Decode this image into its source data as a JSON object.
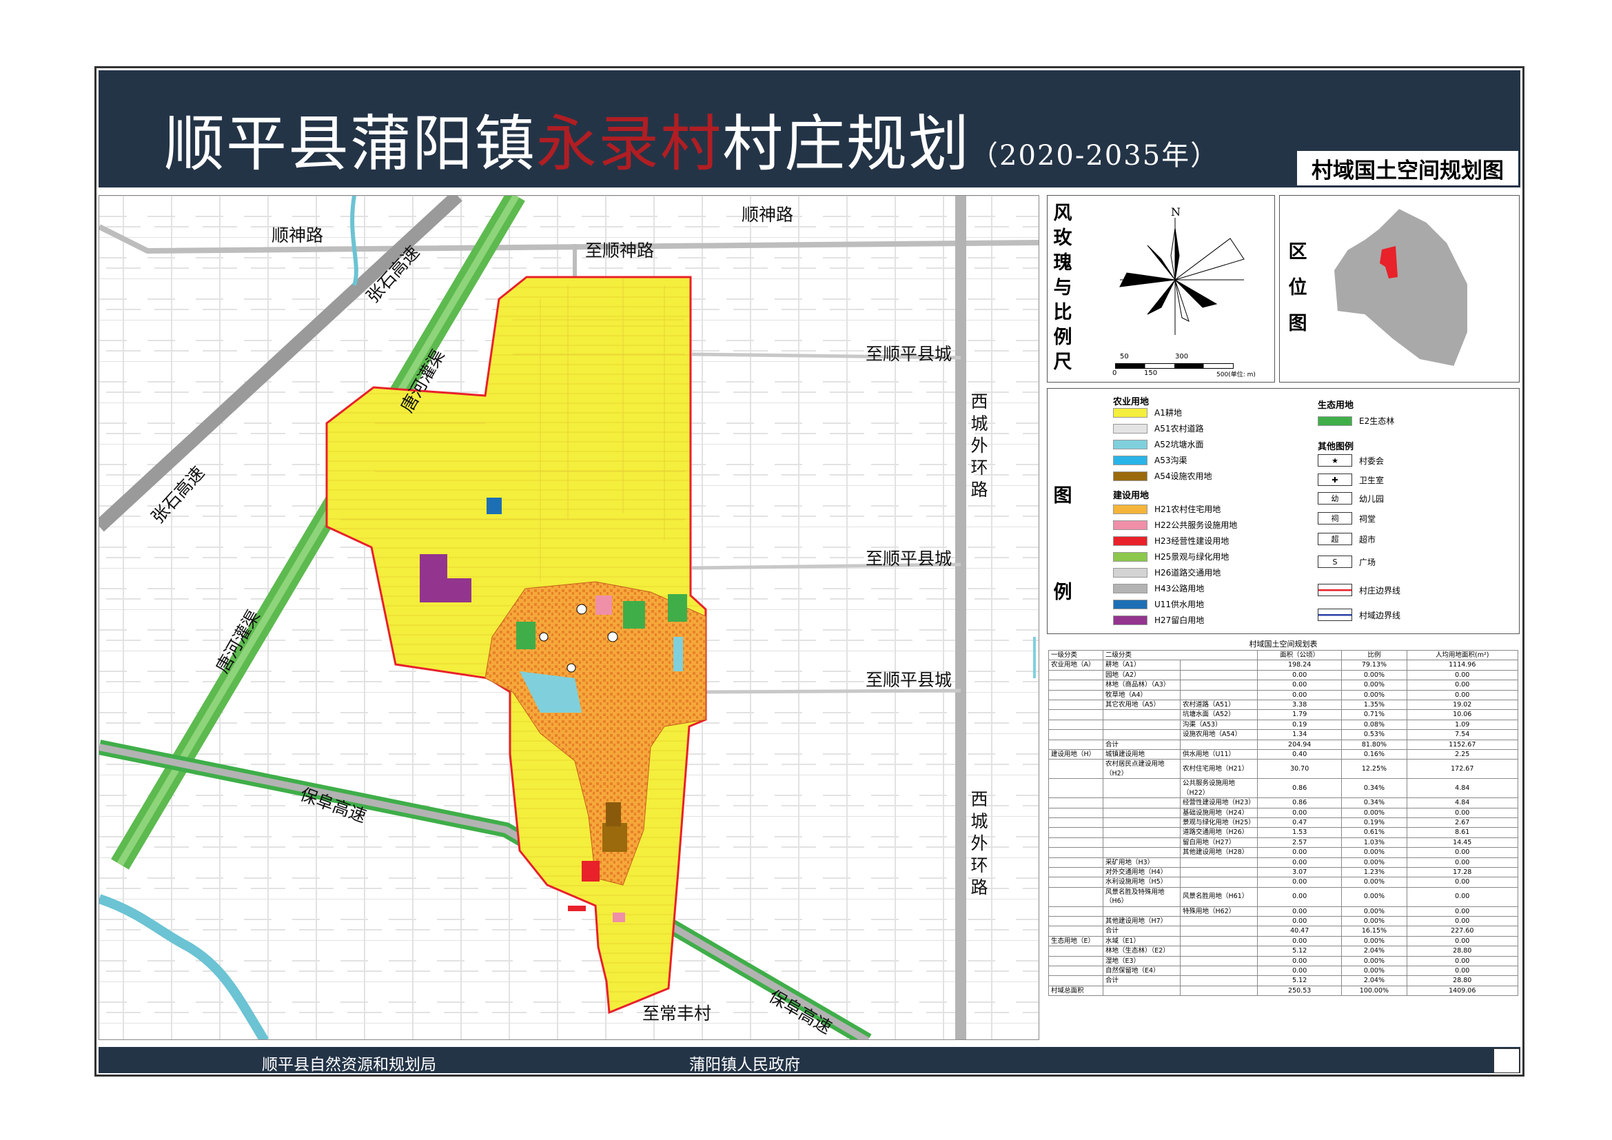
{
  "title": {
    "prefix": "顺平县蒲阳镇",
    "village": "永录村",
    "suffix": "村庄规划",
    "years": "（2020-2035年）"
  },
  "subtitle": "村域国土空间规划图",
  "map": {
    "roads": {
      "shunshen_top": "顺神路",
      "shunshen_left": "顺神路",
      "to_shunshen": "至顺神路",
      "zhangshi_upper": "张石高速",
      "zhangshi_lower": "张石高速",
      "tanghe_upper": "唐河灌渠",
      "tanghe_lower": "唐河灌渠",
      "to_county_1": "至顺平县城",
      "to_county_2": "至顺平县城",
      "to_county_3": "至顺平县城",
      "xicheng_upper": "西城外环路",
      "xicheng_lower": "西城外环路",
      "baofu_left": "保阜高速",
      "baofu_right": "保阜高速",
      "to_changfeng": "至常丰村"
    }
  },
  "rose": {
    "title": "风玫瑰与比例尺",
    "north": "N",
    "scale_top": [
      "50",
      "300"
    ],
    "scale_bottom": [
      "0",
      "150",
      "500(单位: m)"
    ]
  },
  "location": {
    "title": "区位图"
  },
  "legend": {
    "title": "图例",
    "groups": {
      "agri": "农业用地",
      "build": "建设用地",
      "eco": "生态用地",
      "other": "其他图例"
    },
    "items": [
      {
        "label": "A1耕地",
        "color": "#f4ee3c"
      },
      {
        "label": "A51农村道路",
        "color": "#e4e4e4"
      },
      {
        "label": "A52坑塘水面",
        "color": "#7fd0dc"
      },
      {
        "label": "A53沟渠",
        "color": "#2ab3e6"
      },
      {
        "label": "A54设施农用地",
        "color": "#9a6a0c"
      },
      {
        "label": "H21农村住宅用地",
        "color": "#f5b43a"
      },
      {
        "label": "H22公共服务设施用地",
        "color": "#ef8fa8"
      },
      {
        "label": "H23经营性建设用地",
        "color": "#e8212a"
      },
      {
        "label": "H25景观与绿化用地",
        "color": "#8cc84b"
      },
      {
        "label": "H26道路交通用地",
        "color": "#d3d3d3"
      },
      {
        "label": "H43公路用地",
        "color": "#b3b3b3"
      },
      {
        "label": "U11供水用地",
        "color": "#1d6fb5"
      },
      {
        "label": "H27留白用地",
        "color": "#93358e"
      }
    ],
    "eco_items": [
      {
        "label": "E2生态林",
        "color": "#3fae49"
      }
    ],
    "symbols": [
      {
        "label": "村委会",
        "glyph": "★"
      },
      {
        "label": "卫生室",
        "glyph": "✚"
      },
      {
        "label": "幼儿园",
        "glyph": "幼"
      },
      {
        "label": "祠堂",
        "glyph": "祠"
      },
      {
        "label": "超市",
        "glyph": "超"
      },
      {
        "label": "广场",
        "glyph": "S"
      }
    ],
    "lines": [
      {
        "label": "村庄边界线",
        "color": "#e8212a"
      },
      {
        "label": "村域边界线",
        "color": "#2b3fa8"
      }
    ]
  },
  "table": {
    "caption": "村域国土空间规划表",
    "headers": [
      "一级分类",
      "二级分类",
      "面积（公顷）",
      "比例",
      "人均用地面积(m²)"
    ],
    "rows": [
      [
        "农业用地（A）",
        "耕地（A1）",
        "",
        "198.24",
        "79.13%",
        "1114.96"
      ],
      [
        "",
        "园地（A2）",
        "",
        "0.00",
        "0.00%",
        "0.00"
      ],
      [
        "",
        "林地（商品林）（A3）",
        "",
        "0.00",
        "0.00%",
        "0.00"
      ],
      [
        "",
        "牧草地（A4）",
        "",
        "0.00",
        "0.00%",
        "0.00"
      ],
      [
        "",
        "其它农用地（A5）",
        "农村道路（A51）",
        "3.38",
        "1.35%",
        "19.02"
      ],
      [
        "",
        "",
        "坑塘水面（A52）",
        "1.79",
        "0.71%",
        "10.06"
      ],
      [
        "",
        "",
        "沟渠（A53）",
        "0.19",
        "0.08%",
        "1.09"
      ],
      [
        "",
        "",
        "设施农用地（A54）",
        "1.34",
        "0.53%",
        "7.54"
      ],
      [
        "",
        "合计",
        "",
        "204.94",
        "81.80%",
        "1152.67"
      ],
      [
        "建设用地（H）",
        "城镇建设用地",
        "供水用地（U11）",
        "0.40",
        "0.16%",
        "2.25"
      ],
      [
        "",
        "农村居民点建设用地（H2）",
        "农村住宅用地（H21）",
        "30.70",
        "12.25%",
        "172.67"
      ],
      [
        "",
        "",
        "公共服务设施用地（H22）",
        "0.86",
        "0.34%",
        "4.84"
      ],
      [
        "",
        "",
        "经营性建设用地（H23）",
        "0.86",
        "0.34%",
        "4.84"
      ],
      [
        "",
        "",
        "基础设施用地（H24）",
        "0.00",
        "0.00%",
        "0.00"
      ],
      [
        "",
        "",
        "景观与绿化用地（H25）",
        "0.47",
        "0.19%",
        "2.67"
      ],
      [
        "",
        "",
        "道路交通用地（H26）",
        "1.53",
        "0.61%",
        "8.61"
      ],
      [
        "",
        "",
        "留白用地（H27）",
        "2.57",
        "1.03%",
        "14.45"
      ],
      [
        "",
        "",
        "其他建设用地（H28）",
        "0.00",
        "0.00%",
        "0.00"
      ],
      [
        "",
        "采矿用地（H3）",
        "",
        "0.00",
        "0.00%",
        "0.00"
      ],
      [
        "",
        "对外交通用地（H4）",
        "",
        "3.07",
        "1.23%",
        "17.28"
      ],
      [
        "",
        "水利设施用地（H5）",
        "",
        "0.00",
        "0.00%",
        "0.00"
      ],
      [
        "",
        "风景名胜及特殊用地（H6）",
        "风景名胜用地（H61）",
        "0.00",
        "0.00%",
        "0.00"
      ],
      [
        "",
        "",
        "特殊用地（H62）",
        "0.00",
        "0.00%",
        "0.00"
      ],
      [
        "",
        "其他建设用地（H7）",
        "",
        "0.00",
        "0.00%",
        "0.00"
      ],
      [
        "",
        "合计",
        "",
        "40.47",
        "16.15%",
        "227.60"
      ],
      [
        "生态用地（E）",
        "水域（E1）",
        "",
        "0.00",
        "0.00%",
        "0.00"
      ],
      [
        "",
        "林地（生态林）（E2）",
        "",
        "5.12",
        "2.04%",
        "28.80"
      ],
      [
        "",
        "湿地（E3）",
        "",
        "0.00",
        "0.00%",
        "0.00"
      ],
      [
        "",
        "自然保留地（E4）",
        "",
        "0.00",
        "0.00%",
        "0.00"
      ],
      [
        "",
        "合计",
        "",
        "5.12",
        "2.04%",
        "28.80"
      ],
      [
        "村域总面积",
        "",
        "",
        "250.53",
        "100.00%",
        "1409.06"
      ]
    ]
  },
  "footer": {
    "left": "顺平县自然资源和规划局",
    "right": "蒲阳镇人民政府"
  }
}
